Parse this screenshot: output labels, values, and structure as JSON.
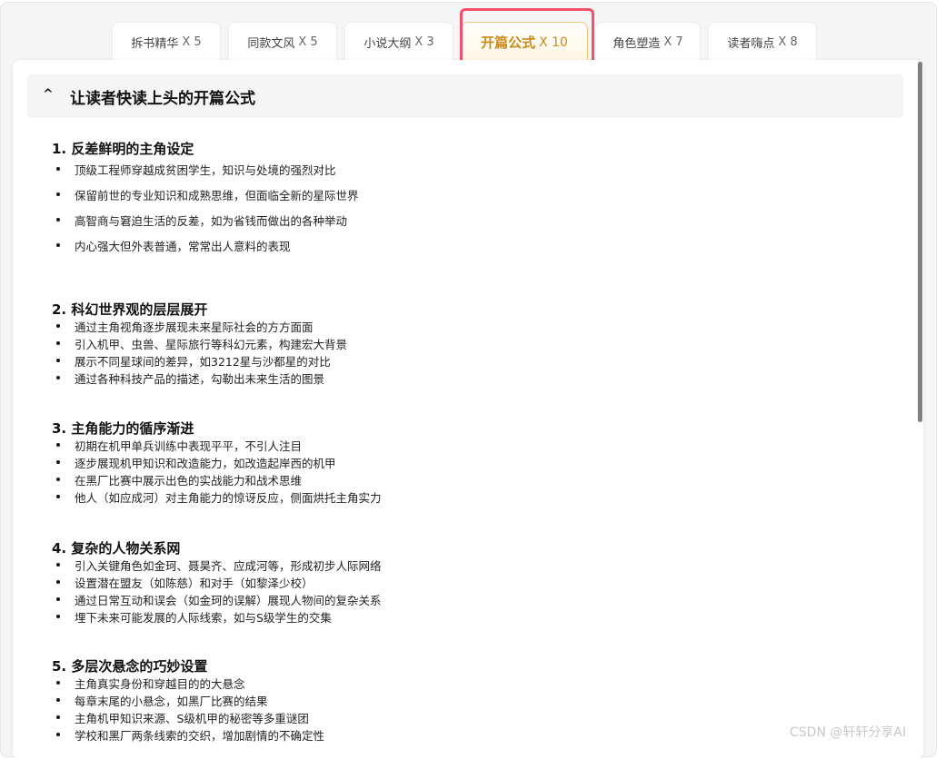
{
  "tabs": [
    {
      "label": "拆书精华",
      "count": "X 5",
      "active": false
    },
    {
      "label": "同款文风",
      "count": "X 5",
      "active": false
    },
    {
      "label": "小说大纲",
      "count": "X 3",
      "active": false
    },
    {
      "label": "开篇公式",
      "count": "X 10",
      "active": true
    },
    {
      "label": "角色塑造",
      "count": "X 7",
      "active": false
    },
    {
      "label": "读者嗨点",
      "count": "X 8",
      "active": false
    }
  ],
  "accordion": {
    "caret": "^",
    "title": "让读者快读上头的开篇公式"
  },
  "sections": [
    {
      "title": "1. 反差鲜明的主角设定",
      "items": [
        "顶级工程师穿越成贫困学生，知识与处境的强烈对比",
        "保留前世的专业知识和成熟思维，但面临全新的星际世界",
        "高智商与窘迫生活的反差，如为省钱而做出的各种举动",
        "内心强大但外表普通，常常出人意料的表现"
      ]
    },
    {
      "title": "2. 科幻世界观的层层展开",
      "items": [
        "通过主角视角逐步展现未来星际社会的方方面面",
        "引入机甲、虫兽、星际旅行等科幻元素，构建宏大背景",
        "展示不同星球间的差异，如3212星与沙都星的对比",
        "通过各种科技产品的描述，勾勒出未来生活的图景"
      ]
    },
    {
      "title": "3. 主角能力的循序渐进",
      "items": [
        "初期在机甲单兵训练中表现平平，不引人注目",
        "逐步展现机甲知识和改造能力，如改造起岸西的机甲",
        "在黑厂比赛中展示出色的实战能力和战术思维",
        "他人（如应成河）对主角能力的惊讶反应，侧面烘托主角实力"
      ]
    },
    {
      "title": "4. 复杂的人物关系网",
      "items": [
        "引入关键角色如金珂、聂昊齐、应成河等，形成初步人际网络",
        "设置潜在盟友（如陈慈）和对手（如黎泽少校）",
        "通过日常互动和误会（如金珂的误解）展现人物间的复杂关系",
        "埋下未来可能发展的人际线索，如与S级学生的交集"
      ]
    },
    {
      "title": "5. 多层次悬念的巧妙设置",
      "items": [
        "主角真实身份和穿越目的的大悬念",
        "每章末尾的小悬念，如黑厂比赛的结果",
        "主角机甲知识来源、S级机甲的秘密等多重谜团",
        "学校和黑厂两条线索的交织，增加剧情的不确定性"
      ]
    }
  ],
  "watermark": "CSDN @轩轩分享AI"
}
